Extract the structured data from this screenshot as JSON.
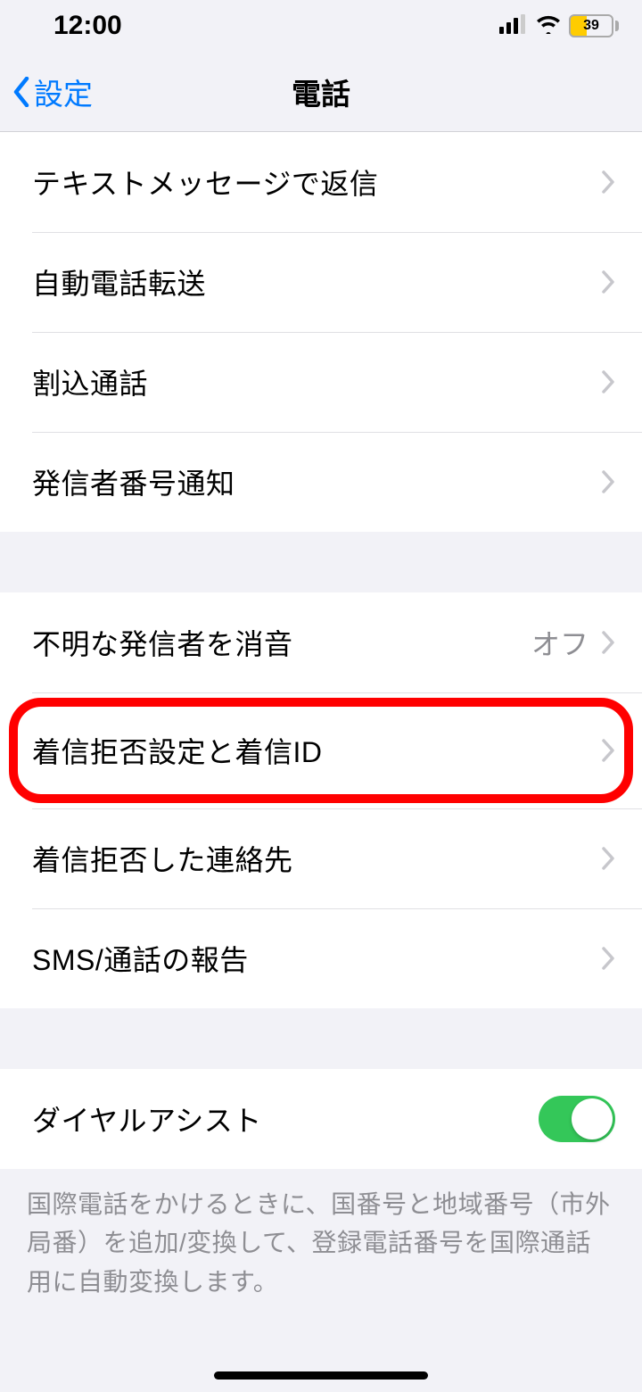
{
  "status": {
    "time": "12:00",
    "battery": "39"
  },
  "nav": {
    "back": "設定",
    "title": "電話"
  },
  "group1": {
    "items": [
      {
        "label": "テキストメッセージで返信"
      },
      {
        "label": "自動電話転送"
      },
      {
        "label": "割込通話"
      },
      {
        "label": "発信者番号通知"
      }
    ]
  },
  "group2": {
    "items": [
      {
        "label": "不明な発信者を消音",
        "value": "オフ"
      },
      {
        "label": "着信拒否設定と着信ID"
      },
      {
        "label": "着信拒否した連絡先"
      },
      {
        "label": "SMS/通話の報告"
      }
    ]
  },
  "group3": {
    "items": [
      {
        "label": "ダイヤルアシスト"
      }
    ],
    "footer": "国際電話をかけるときに、国番号と地域番号（市外局番）を追加/変換して、登録電話番号を国際通話用に自動変換します。"
  }
}
